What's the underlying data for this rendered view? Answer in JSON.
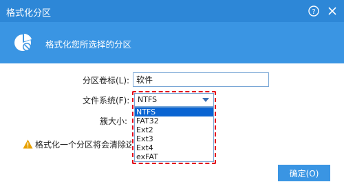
{
  "window": {
    "title": "格式化分区",
    "help_icon": "?",
    "close_icon": "×"
  },
  "header": {
    "subtitle": "格式化您所选择的分区",
    "logo_icon": "partition-pie-icon"
  },
  "form": {
    "volume_label_caption": "分区卷标(L):",
    "volume_label_value": "软件",
    "filesystem_caption": "文件系统(F):",
    "filesystem_selected": "NTFS",
    "filesystem_options": [
      "NTFS",
      "FAT32",
      "Ext2",
      "Ext3",
      "Ext4",
      "exFAT"
    ],
    "cluster_caption": "簇大小:"
  },
  "warning": {
    "text": "格式化一个分区将会清除这",
    "icon": "warning-triangle-icon",
    "color": "#e8a100"
  },
  "buttons": {
    "ok": "确定(O)"
  },
  "colors": {
    "titlebar": "#2d87d7",
    "header": "#3a95e3",
    "highlight_border": "#e0001a",
    "selected_option": "#0a64d2"
  }
}
